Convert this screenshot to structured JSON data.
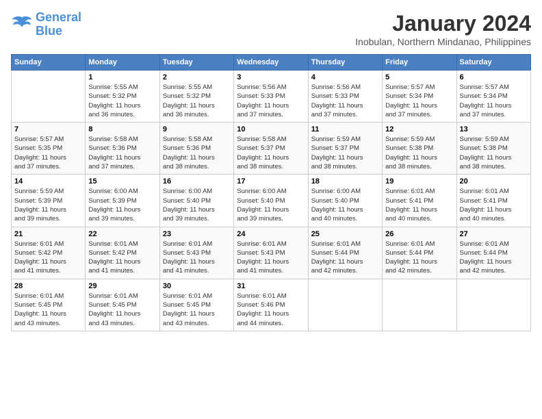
{
  "logo": {
    "line1": "General",
    "line2": "Blue"
  },
  "title": "January 2024",
  "location": "Inobulan, Northern Mindanao, Philippines",
  "weekdays": [
    "Sunday",
    "Monday",
    "Tuesday",
    "Wednesday",
    "Thursday",
    "Friday",
    "Saturday"
  ],
  "weeks": [
    [
      {
        "day": "",
        "info": ""
      },
      {
        "day": "1",
        "info": "Sunrise: 5:55 AM\nSunset: 5:32 PM\nDaylight: 11 hours\nand 36 minutes."
      },
      {
        "day": "2",
        "info": "Sunrise: 5:55 AM\nSunset: 5:32 PM\nDaylight: 11 hours\nand 36 minutes."
      },
      {
        "day": "3",
        "info": "Sunrise: 5:56 AM\nSunset: 5:33 PM\nDaylight: 11 hours\nand 37 minutes."
      },
      {
        "day": "4",
        "info": "Sunrise: 5:56 AM\nSunset: 5:33 PM\nDaylight: 11 hours\nand 37 minutes."
      },
      {
        "day": "5",
        "info": "Sunrise: 5:57 AM\nSunset: 5:34 PM\nDaylight: 11 hours\nand 37 minutes."
      },
      {
        "day": "6",
        "info": "Sunrise: 5:57 AM\nSunset: 5:34 PM\nDaylight: 11 hours\nand 37 minutes."
      }
    ],
    [
      {
        "day": "7",
        "info": "Sunrise: 5:57 AM\nSunset: 5:35 PM\nDaylight: 11 hours\nand 37 minutes."
      },
      {
        "day": "8",
        "info": "Sunrise: 5:58 AM\nSunset: 5:36 PM\nDaylight: 11 hours\nand 37 minutes."
      },
      {
        "day": "9",
        "info": "Sunrise: 5:58 AM\nSunset: 5:36 PM\nDaylight: 11 hours\nand 38 minutes."
      },
      {
        "day": "10",
        "info": "Sunrise: 5:58 AM\nSunset: 5:37 PM\nDaylight: 11 hours\nand 38 minutes."
      },
      {
        "day": "11",
        "info": "Sunrise: 5:59 AM\nSunset: 5:37 PM\nDaylight: 11 hours\nand 38 minutes."
      },
      {
        "day": "12",
        "info": "Sunrise: 5:59 AM\nSunset: 5:38 PM\nDaylight: 11 hours\nand 38 minutes."
      },
      {
        "day": "13",
        "info": "Sunrise: 5:59 AM\nSunset: 5:38 PM\nDaylight: 11 hours\nand 38 minutes."
      }
    ],
    [
      {
        "day": "14",
        "info": "Sunrise: 5:59 AM\nSunset: 5:39 PM\nDaylight: 11 hours\nand 39 minutes."
      },
      {
        "day": "15",
        "info": "Sunrise: 6:00 AM\nSunset: 5:39 PM\nDaylight: 11 hours\nand 39 minutes."
      },
      {
        "day": "16",
        "info": "Sunrise: 6:00 AM\nSunset: 5:40 PM\nDaylight: 11 hours\nand 39 minutes."
      },
      {
        "day": "17",
        "info": "Sunrise: 6:00 AM\nSunset: 5:40 PM\nDaylight: 11 hours\nand 39 minutes."
      },
      {
        "day": "18",
        "info": "Sunrise: 6:00 AM\nSunset: 5:40 PM\nDaylight: 11 hours\nand 40 minutes."
      },
      {
        "day": "19",
        "info": "Sunrise: 6:01 AM\nSunset: 5:41 PM\nDaylight: 11 hours\nand 40 minutes."
      },
      {
        "day": "20",
        "info": "Sunrise: 6:01 AM\nSunset: 5:41 PM\nDaylight: 11 hours\nand 40 minutes."
      }
    ],
    [
      {
        "day": "21",
        "info": "Sunrise: 6:01 AM\nSunset: 5:42 PM\nDaylight: 11 hours\nand 41 minutes."
      },
      {
        "day": "22",
        "info": "Sunrise: 6:01 AM\nSunset: 5:42 PM\nDaylight: 11 hours\nand 41 minutes."
      },
      {
        "day": "23",
        "info": "Sunrise: 6:01 AM\nSunset: 5:43 PM\nDaylight: 11 hours\nand 41 minutes."
      },
      {
        "day": "24",
        "info": "Sunrise: 6:01 AM\nSunset: 5:43 PM\nDaylight: 11 hours\nand 41 minutes."
      },
      {
        "day": "25",
        "info": "Sunrise: 6:01 AM\nSunset: 5:44 PM\nDaylight: 11 hours\nand 42 minutes."
      },
      {
        "day": "26",
        "info": "Sunrise: 6:01 AM\nSunset: 5:44 PM\nDaylight: 11 hours\nand 42 minutes."
      },
      {
        "day": "27",
        "info": "Sunrise: 6:01 AM\nSunset: 5:44 PM\nDaylight: 11 hours\nand 42 minutes."
      }
    ],
    [
      {
        "day": "28",
        "info": "Sunrise: 6:01 AM\nSunset: 5:45 PM\nDaylight: 11 hours\nand 43 minutes."
      },
      {
        "day": "29",
        "info": "Sunrise: 6:01 AM\nSunset: 5:45 PM\nDaylight: 11 hours\nand 43 minutes."
      },
      {
        "day": "30",
        "info": "Sunrise: 6:01 AM\nSunset: 5:45 PM\nDaylight: 11 hours\nand 43 minutes."
      },
      {
        "day": "31",
        "info": "Sunrise: 6:01 AM\nSunset: 5:46 PM\nDaylight: 11 hours\nand 44 minutes."
      },
      {
        "day": "",
        "info": ""
      },
      {
        "day": "",
        "info": ""
      },
      {
        "day": "",
        "info": ""
      }
    ]
  ]
}
